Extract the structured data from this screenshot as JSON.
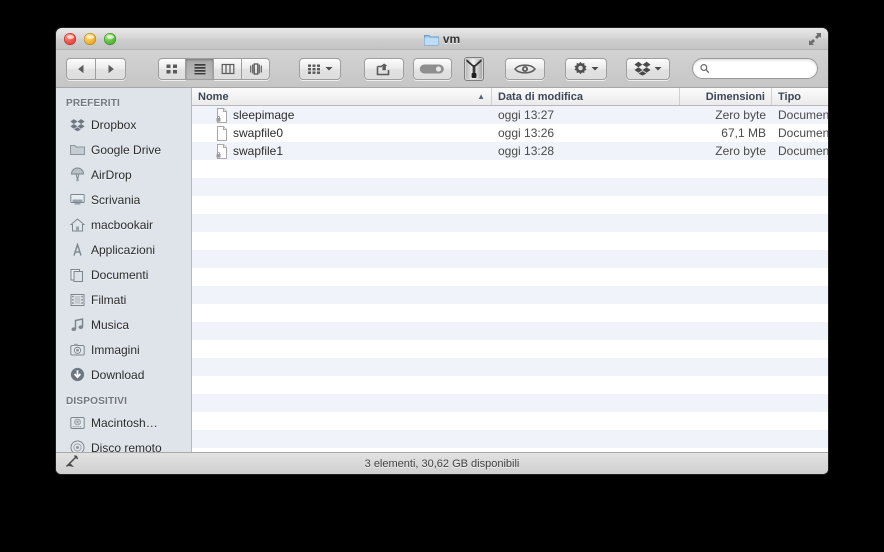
{
  "window": {
    "title": "vm",
    "title_icon": "folder-icon",
    "traffic_lights": [
      "close-button",
      "minimize-button",
      "zoom-button"
    ],
    "fullscreen_icon": "fullscreen-arrows-icon"
  },
  "toolbar": {
    "nav": {
      "back_icon": "back-arrow-icon",
      "forward_icon": "forward-arrow-icon"
    },
    "views": [
      {
        "name": "icon-view",
        "icon": "grid-icon",
        "active": false
      },
      {
        "name": "list-view",
        "icon": "list-icon",
        "active": true
      },
      {
        "name": "column-view",
        "icon": "columns-icon",
        "active": false
      },
      {
        "name": "coverflow-view",
        "icon": "coverflow-icon",
        "active": false
      }
    ],
    "arrange_icon": "arrange-grid-icon",
    "share_icon": "share-icon",
    "tags_icon": "tags-pill-icon",
    "zipper_icon": "zipper-icon",
    "quicklook_icon": "eye-icon",
    "action_icon": "gear-icon",
    "dropbox_icon": "dropbox-icon",
    "search": {
      "value": "",
      "placeholder": "",
      "icon": "search-icon"
    }
  },
  "sidebar": {
    "sections": [
      {
        "header": "PREFERITI",
        "items": [
          {
            "label": "Dropbox",
            "icon": "dropbox-icon"
          },
          {
            "label": "Google Drive",
            "icon": "folder-icon"
          },
          {
            "label": "AirDrop",
            "icon": "airdrop-icon"
          },
          {
            "label": "Scrivania",
            "icon": "desktop-icon"
          },
          {
            "label": "macbookair",
            "icon": "home-icon"
          },
          {
            "label": "Applicazioni",
            "icon": "applications-icon"
          },
          {
            "label": "Documenti",
            "icon": "documents-icon"
          },
          {
            "label": "Filmati",
            "icon": "movies-icon"
          },
          {
            "label": "Musica",
            "icon": "music-note-icon"
          },
          {
            "label": "Immagini",
            "icon": "camera-icon"
          },
          {
            "label": "Download",
            "icon": "download-arrow-icon"
          }
        ]
      },
      {
        "header": "DISPOSITIVI",
        "items": [
          {
            "label": "Macintosh…",
            "icon": "hard-disk-icon"
          },
          {
            "label": "Disco remoto",
            "icon": "optical-disc-icon"
          }
        ]
      }
    ]
  },
  "filelist": {
    "columns": [
      {
        "label": "Nome",
        "sort": "asc"
      },
      {
        "label": "Data di modifica",
        "sort": null
      },
      {
        "label": "Dimensioni",
        "sort": null
      },
      {
        "label": "Tipo",
        "sort": null
      }
    ],
    "sort_indicator": "▲",
    "rows": [
      {
        "name": "sleepimage",
        "date": "oggi 13:27",
        "size": "Zero byte",
        "type": "Documento",
        "locked": true
      },
      {
        "name": "swapfile0",
        "date": "oggi 13:26",
        "size": "67,1 MB",
        "type": "Documento",
        "locked": false
      },
      {
        "name": "swapfile1",
        "date": "oggi 13:28",
        "size": "Zero byte",
        "type": "Documento",
        "locked": true
      }
    ]
  },
  "statusbar": {
    "text": "3 elementi, 30,62 GB disponibili",
    "icon": "quill-pen-icon"
  },
  "colors": {
    "stripe": "#f0f3fa",
    "sidebar_bg": "#dfe4ea",
    "header_text": "#3d4758"
  }
}
